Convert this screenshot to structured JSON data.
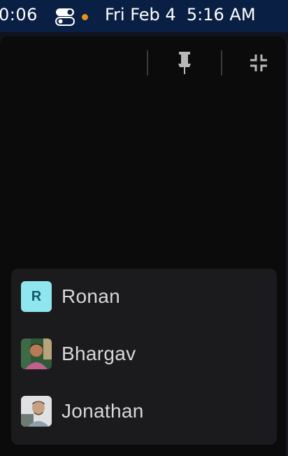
{
  "menubar": {
    "clock_partial": "0:06",
    "date_time": "Fri Feb 4  5:16 AM",
    "icons": [
      "toggle-icon",
      "status-dot"
    ],
    "colors": {
      "background": "#0a1f44",
      "dot": "#e2931a"
    }
  },
  "toolbar": {
    "icons": [
      "pin-icon",
      "minimize-icon"
    ]
  },
  "participants": [
    {
      "name": "Ronan",
      "avatar_initial": "R",
      "avatar_color": "#8fe6ef"
    },
    {
      "name": "Bhargav",
      "avatar_initial": "",
      "avatar_color": ""
    },
    {
      "name": "Jonathan",
      "avatar_initial": "",
      "avatar_color": ""
    }
  ]
}
